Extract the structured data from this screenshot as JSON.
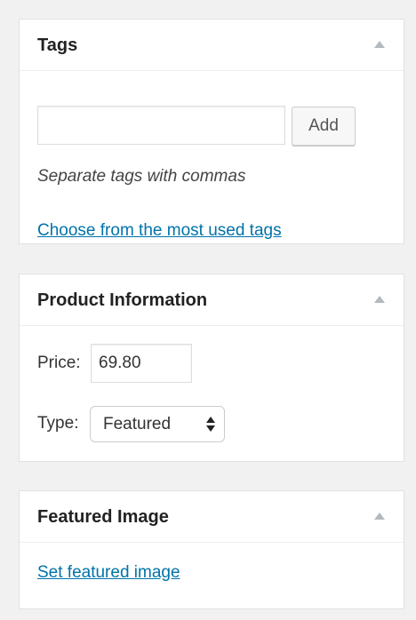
{
  "colors": {
    "background": "#f1f1f1",
    "panel": "#ffffff",
    "link": "#0073aa"
  },
  "tags_panel": {
    "title": "Tags",
    "toggle_icon": "arrow-up-icon",
    "tag_input": {
      "value": "",
      "placeholder": ""
    },
    "add_label": "Add",
    "hint": "Separate tags with commas",
    "most_used_link": "Choose from the most used tags"
  },
  "product_panel": {
    "title": "Product Information",
    "toggle_icon": "arrow-up-icon",
    "price_label": "Price:",
    "price_value": "69.80",
    "type_label": "Type:",
    "type_selected": "Featured",
    "select_icon": "updown-arrows-icon"
  },
  "featured_panel": {
    "title": "Featured Image",
    "toggle_icon": "arrow-up-icon",
    "set_link": "Set featured image"
  }
}
